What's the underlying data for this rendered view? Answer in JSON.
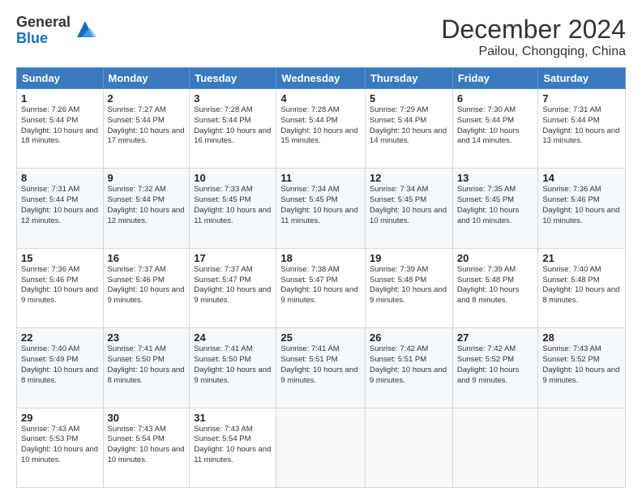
{
  "header": {
    "logo_general": "General",
    "logo_blue": "Blue",
    "month": "December 2024",
    "location": "Pailou, Chongqing, China"
  },
  "days_of_week": [
    "Sunday",
    "Monday",
    "Tuesday",
    "Wednesday",
    "Thursday",
    "Friday",
    "Saturday"
  ],
  "weeks": [
    [
      {
        "day": "1",
        "sunrise": "7:26 AM",
        "sunset": "5:44 PM",
        "daylight": "10 hours and 18 minutes."
      },
      {
        "day": "2",
        "sunrise": "7:27 AM",
        "sunset": "5:44 PM",
        "daylight": "10 hours and 17 minutes."
      },
      {
        "day": "3",
        "sunrise": "7:28 AM",
        "sunset": "5:44 PM",
        "daylight": "10 hours and 16 minutes."
      },
      {
        "day": "4",
        "sunrise": "7:28 AM",
        "sunset": "5:44 PM",
        "daylight": "10 hours and 15 minutes."
      },
      {
        "day": "5",
        "sunrise": "7:29 AM",
        "sunset": "5:44 PM",
        "daylight": "10 hours and 14 minutes."
      },
      {
        "day": "6",
        "sunrise": "7:30 AM",
        "sunset": "5:44 PM",
        "daylight": "10 hours and 14 minutes."
      },
      {
        "day": "7",
        "sunrise": "7:31 AM",
        "sunset": "5:44 PM",
        "daylight": "10 hours and 13 minutes."
      }
    ],
    [
      {
        "day": "8",
        "sunrise": "7:31 AM",
        "sunset": "5:44 PM",
        "daylight": "10 hours and 12 minutes."
      },
      {
        "day": "9",
        "sunrise": "7:32 AM",
        "sunset": "5:44 PM",
        "daylight": "10 hours and 12 minutes."
      },
      {
        "day": "10",
        "sunrise": "7:33 AM",
        "sunset": "5:45 PM",
        "daylight": "10 hours and 11 minutes."
      },
      {
        "day": "11",
        "sunrise": "7:34 AM",
        "sunset": "5:45 PM",
        "daylight": "10 hours and 11 minutes."
      },
      {
        "day": "12",
        "sunrise": "7:34 AM",
        "sunset": "5:45 PM",
        "daylight": "10 hours and 10 minutes."
      },
      {
        "day": "13",
        "sunrise": "7:35 AM",
        "sunset": "5:45 PM",
        "daylight": "10 hours and 10 minutes."
      },
      {
        "day": "14",
        "sunrise": "7:36 AM",
        "sunset": "5:46 PM",
        "daylight": "10 hours and 10 minutes."
      }
    ],
    [
      {
        "day": "15",
        "sunrise": "7:36 AM",
        "sunset": "5:46 PM",
        "daylight": "10 hours and 9 minutes."
      },
      {
        "day": "16",
        "sunrise": "7:37 AM",
        "sunset": "5:46 PM",
        "daylight": "10 hours and 9 minutes."
      },
      {
        "day": "17",
        "sunrise": "7:37 AM",
        "sunset": "5:47 PM",
        "daylight": "10 hours and 9 minutes."
      },
      {
        "day": "18",
        "sunrise": "7:38 AM",
        "sunset": "5:47 PM",
        "daylight": "10 hours and 9 minutes."
      },
      {
        "day": "19",
        "sunrise": "7:39 AM",
        "sunset": "5:48 PM",
        "daylight": "10 hours and 9 minutes."
      },
      {
        "day": "20",
        "sunrise": "7:39 AM",
        "sunset": "5:48 PM",
        "daylight": "10 hours and 8 minutes."
      },
      {
        "day": "21",
        "sunrise": "7:40 AM",
        "sunset": "5:48 PM",
        "daylight": "10 hours and 8 minutes."
      }
    ],
    [
      {
        "day": "22",
        "sunrise": "7:40 AM",
        "sunset": "5:49 PM",
        "daylight": "10 hours and 8 minutes."
      },
      {
        "day": "23",
        "sunrise": "7:41 AM",
        "sunset": "5:50 PM",
        "daylight": "10 hours and 8 minutes."
      },
      {
        "day": "24",
        "sunrise": "7:41 AM",
        "sunset": "5:50 PM",
        "daylight": "10 hours and 9 minutes."
      },
      {
        "day": "25",
        "sunrise": "7:41 AM",
        "sunset": "5:51 PM",
        "daylight": "10 hours and 9 minutes."
      },
      {
        "day": "26",
        "sunrise": "7:42 AM",
        "sunset": "5:51 PM",
        "daylight": "10 hours and 9 minutes."
      },
      {
        "day": "27",
        "sunrise": "7:42 AM",
        "sunset": "5:52 PM",
        "daylight": "10 hours and 9 minutes."
      },
      {
        "day": "28",
        "sunrise": "7:43 AM",
        "sunset": "5:52 PM",
        "daylight": "10 hours and 9 minutes."
      }
    ],
    [
      {
        "day": "29",
        "sunrise": "7:43 AM",
        "sunset": "5:53 PM",
        "daylight": "10 hours and 10 minutes."
      },
      {
        "day": "30",
        "sunrise": "7:43 AM",
        "sunset": "5:54 PM",
        "daylight": "10 hours and 10 minutes."
      },
      {
        "day": "31",
        "sunrise": "7:43 AM",
        "sunset": "5:54 PM",
        "daylight": "10 hours and 11 minutes."
      },
      null,
      null,
      null,
      null
    ]
  ],
  "labels": {
    "sunrise": "Sunrise:",
    "sunset": "Sunset:",
    "daylight": "Daylight:"
  }
}
